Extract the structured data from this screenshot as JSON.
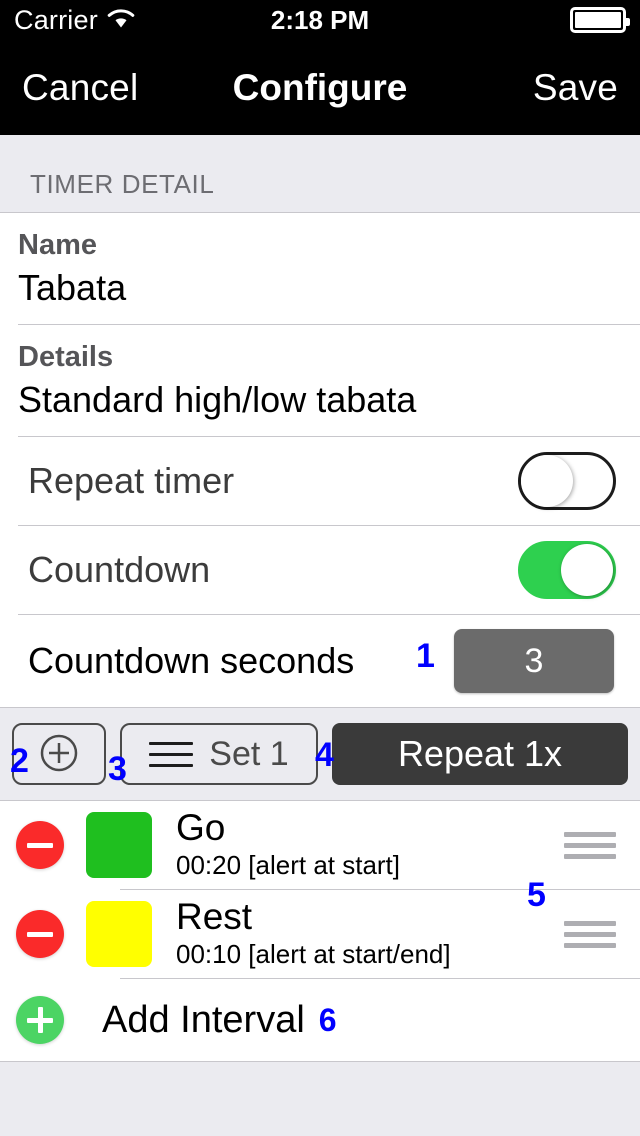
{
  "status_bar": {
    "carrier": "Carrier",
    "wifi_icon": "wifi-icon",
    "time": "2:18 PM",
    "battery_icon": "battery-full-icon"
  },
  "nav_bar": {
    "cancel_label": "Cancel",
    "title": "Configure",
    "save_label": "Save"
  },
  "section": {
    "header": "TIMER DETAIL"
  },
  "fields": {
    "name_label": "Name",
    "name_value": "Tabata",
    "details_label": "Details",
    "details_value": "Standard high/low tabata"
  },
  "toggles": [
    {
      "label": "Repeat timer",
      "state": "off"
    },
    {
      "label": "Countdown",
      "state": "on"
    }
  ],
  "countdown_seconds": {
    "label": "Countdown seconds",
    "value": "3"
  },
  "toolbar": {
    "add_set_icon": "plus-circle-icon",
    "set_icon": "hamburger-icon",
    "set_label": "Set 1",
    "repeat_label": "Repeat 1x"
  },
  "intervals": [
    {
      "delete_icon": "minus-circle-icon",
      "color": "#1fbf1f",
      "title": "Go",
      "subtitle": "00:20 [alert at start]",
      "drag_icon": "reorder-handle-icon"
    },
    {
      "delete_icon": "minus-circle-icon",
      "color": "#ffff00",
      "title": "Rest",
      "subtitle": "00:10 [alert at start/end]",
      "drag_icon": "reorder-handle-icon"
    }
  ],
  "add_interval": {
    "icon": "plus-circle-icon",
    "label": "Add Interval"
  },
  "annotations": {
    "n1": "1",
    "n2": "2",
    "n3": "3",
    "n4": "4",
    "n5": "5",
    "n6": "6"
  },
  "colors": {
    "annotation": "#0000ff",
    "switch_on": "#2ed04f",
    "delete_red": "#fa2a2a",
    "add_green": "#4cd464",
    "repeat_button": "#3a3a3a",
    "stepper": "#6b6b6b",
    "section_bg": "#ebebf0"
  }
}
